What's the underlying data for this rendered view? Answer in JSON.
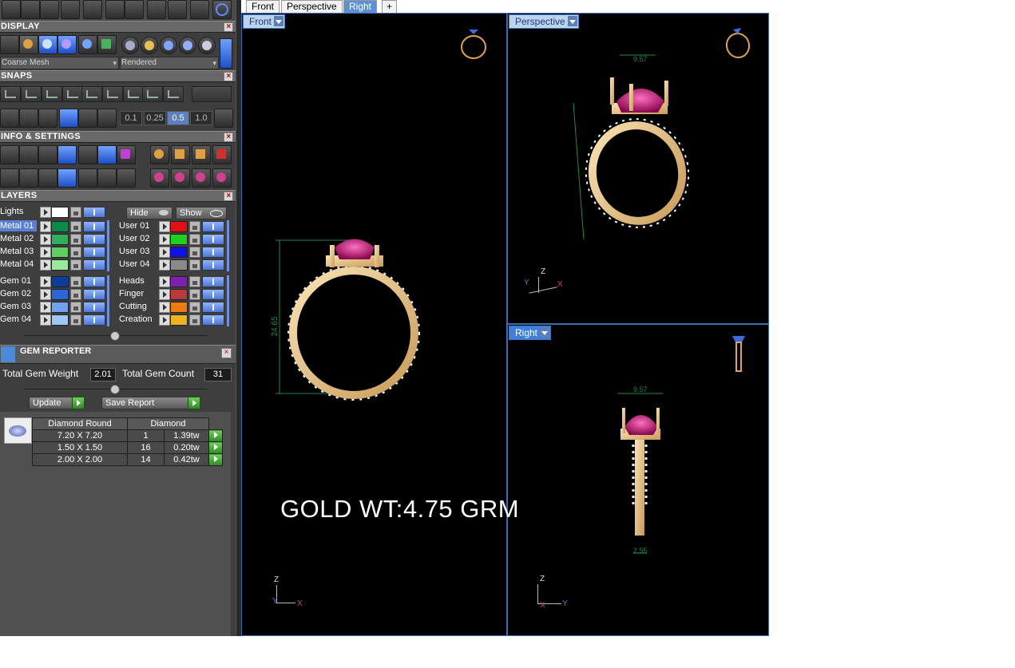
{
  "colors": {
    "panel_bg": "#3e3e3e",
    "header_bg": "#686868",
    "viewport_bg": "#000000",
    "accent": "#5b7fd2",
    "gold": "#e8c48a",
    "gem": "#c0157a"
  },
  "tabs": [
    "Front",
    "Perspective",
    "Right"
  ],
  "tab_add_icon": "plus-icon",
  "display": {
    "title": "DISPLAY",
    "mesh_select": "Coarse Mesh",
    "render_select": "Rendered"
  },
  "snaps": {
    "title": "SNAPS",
    "increments": [
      "0.1",
      "0.25",
      "0.5",
      "1.0"
    ]
  },
  "info": {
    "title": "INFO & SETTINGS"
  },
  "layers": {
    "title": "LAYERS",
    "lights_label": "Lights",
    "hide_label": "Hide",
    "show_label": "Show",
    "left": [
      {
        "name": "Metal 01",
        "color": "#0c8a4a"
      },
      {
        "name": "Metal 02",
        "color": "#2fb05a"
      },
      {
        "name": "Metal 03",
        "color": "#5fd05e"
      },
      {
        "name": "Metal 04",
        "color": "#98ea9a"
      },
      {
        "name": "Gem 01",
        "color": "#0a3d9c"
      },
      {
        "name": "Gem 02",
        "color": "#2c67d8"
      },
      {
        "name": "Gem 03",
        "color": "#6fa3f0"
      },
      {
        "name": "Gem 04",
        "color": "#9fc6f6"
      }
    ],
    "right": [
      {
        "name": "User 01",
        "color": "#e01010"
      },
      {
        "name": "User 02",
        "color": "#20d020"
      },
      {
        "name": "User 03",
        "color": "#1010e0"
      },
      {
        "name": "User 04",
        "color": "#8a8a8a"
      },
      {
        "name": "Heads",
        "color": "#7e20b0"
      },
      {
        "name": "Finger",
        "color": "#b83b3b"
      },
      {
        "name": "Cutting",
        "color": "#f07a10"
      },
      {
        "name": "Creation",
        "color": "#f0b020"
      }
    ]
  },
  "gem_reporter": {
    "title": "GEM REPORTER",
    "total_weight_label": "Total Gem Weight",
    "total_weight": "2.01",
    "total_count_label": "Total Gem Count",
    "total_count": "31",
    "update_label": "Update",
    "save_label": "Save Report",
    "table_headers": [
      "Diamond Round",
      "Diamond"
    ],
    "rows": [
      {
        "size": "7.20 X 7.20",
        "count": "1",
        "weight": "1.39tw"
      },
      {
        "size": "1.50 X 1.50",
        "count": "16",
        "weight": "0.20tw"
      },
      {
        "size": "2.00 X 2.00",
        "count": "14",
        "weight": "0.42tw"
      }
    ]
  },
  "viewports": {
    "front": {
      "label": "Front",
      "dimension": "24.65"
    },
    "perspective": {
      "label": "Perspective",
      "dimension_top": "9.57"
    },
    "right": {
      "label": "Right",
      "dimension_top": "9.57",
      "dimension_bottom": "2.55"
    }
  },
  "axes": {
    "z": "Z",
    "y": "Y",
    "x": "X"
  },
  "overlay_text": "GOLD WT:4.75 GRM"
}
